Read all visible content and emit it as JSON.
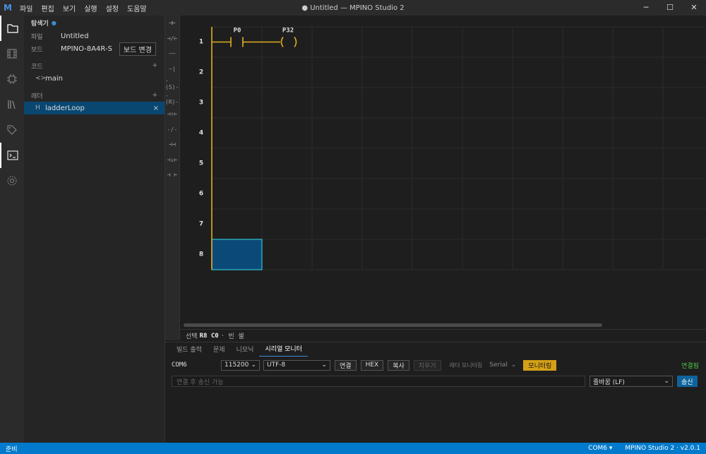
{
  "titlebar": {
    "menu": [
      "파일",
      "편집",
      "보기",
      "실행",
      "설정",
      "도움말"
    ],
    "title": "● Untitled — MPINO Studio 2",
    "logo": "M"
  },
  "explorer": {
    "header": "탐색기",
    "file_key": "파일",
    "file_val": "Untitled",
    "board_key": "보드",
    "board_val": "MPINO-8A4R-S",
    "board_btn": "보드 변경",
    "code_section": "코드",
    "code_items": [
      "main"
    ],
    "ladder_section": "래더",
    "ladder_items": [
      "ladderLoop"
    ],
    "add_symbol": "+",
    "close_symbol": "×"
  },
  "toolbox": [
    "⊣⊢",
    "⊣/⊢",
    "——",
    "—|",
    "-(S)-",
    "-(R)-",
    "⊣↑⊢",
    "-/-",
    "⊣⊣",
    "⊣↓⊢",
    "⊣ ⊢"
  ],
  "ladder": {
    "rows": [
      "1",
      "2",
      "3",
      "4",
      "5",
      "6",
      "7",
      "8"
    ],
    "contact1": "P0",
    "coil1": "P32",
    "rail_color": "#e0b020",
    "selected_row": 8,
    "selected_col": 0
  },
  "status": {
    "prefix": "선택",
    "pos": "R8 C0",
    "sep": "·",
    "desc": "빈 셀"
  },
  "bottom": {
    "tabs": [
      "빌드 출력",
      "문제",
      "니모닉",
      "시리얼 모니터"
    ],
    "port": "COM6",
    "baud": "115200",
    "encoding": "UTF-8",
    "buttons": {
      "connect": "연결",
      "hex": "HEX",
      "copy": "복사",
      "clear": "지우기"
    },
    "ladder_mon_label": "래더 모니터링",
    "ladder_mon_sel": "Serial",
    "monitor_btn": "모니터링",
    "connected": "연결됨",
    "send_placeholder": "연결 후 송신 가능",
    "line_end": "줄바꿈 (LF)",
    "send_btn": "송신"
  },
  "footer": {
    "left": "준비",
    "port": "COM6",
    "version": "MPINO Studio 2 · v2.0.1"
  }
}
